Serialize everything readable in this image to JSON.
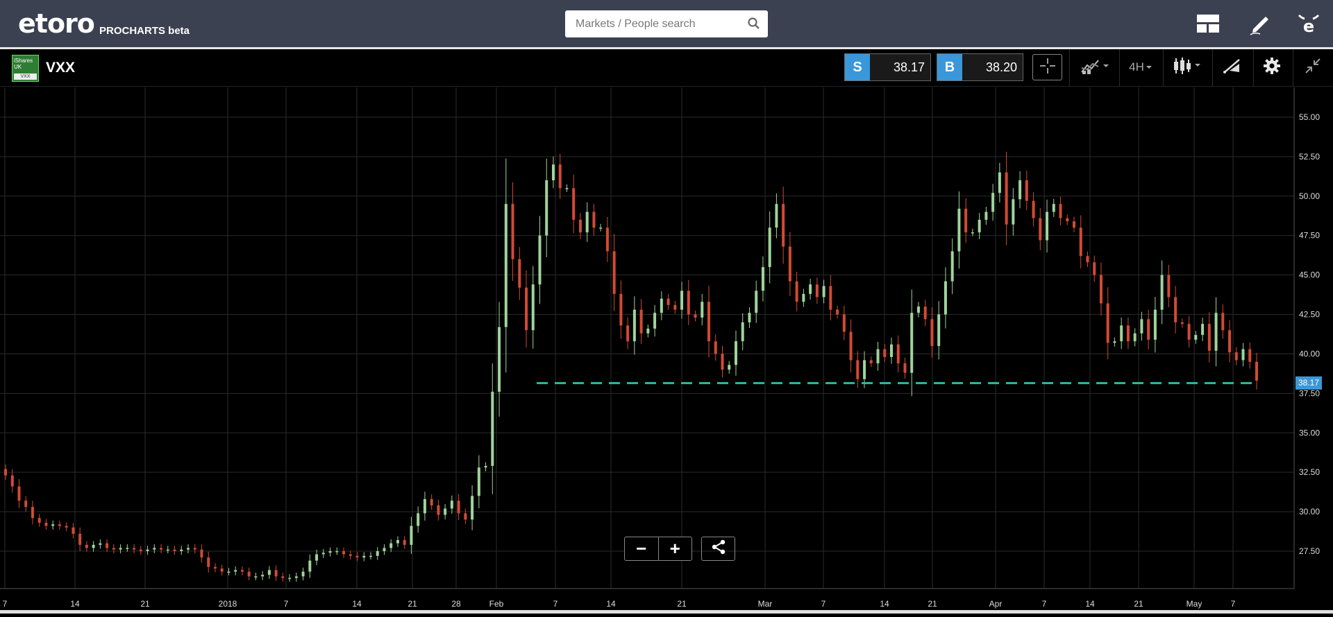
{
  "header": {
    "logo_text": "etoro",
    "logo_sub": "PROCHARTS beta",
    "search_placeholder": "Markets / People search",
    "icons": [
      "layout-icon",
      "pencil-icon",
      "etoro-e-icon"
    ]
  },
  "instrument": {
    "logo_lines": [
      "iShares",
      "UK"
    ],
    "logo_ticker": "VXX",
    "name": "VXX",
    "sell_label": "S",
    "sell_price": "38.17",
    "buy_label": "B",
    "buy_price": "38.20",
    "timeframe": "4H"
  },
  "chart_controls": {
    "zoom_out": "−",
    "zoom_in": "+"
  },
  "colors": {
    "up": "#9fd49b",
    "down": "#d24a34",
    "dashed_line": "#2fb9a0",
    "price_tag": "#3a97d9",
    "grid": "#2b2b2b"
  },
  "chart_data": {
    "type": "candlestick",
    "y_ticks": [
      "55.00",
      "52.50",
      "50.00",
      "47.50",
      "45.00",
      "42.50",
      "40.00",
      "37.50",
      "35.00",
      "32.50",
      "30.00",
      "27.50"
    ],
    "x_ticks": [
      "7",
      "14",
      "21",
      "2018",
      "7",
      "14",
      "21",
      "28",
      "Feb",
      "7",
      "14",
      "21",
      "Mar",
      "7",
      "14",
      "21",
      "Apr",
      "7",
      "14",
      "21",
      "May",
      "7"
    ],
    "ylim": [
      25.5,
      56.8
    ],
    "current_price_label": "38.17",
    "horizontal_line_value": 38.15,
    "grid": true,
    "closes": [
      32.3,
      31.6,
      30.7,
      30.3,
      29.6,
      29.3,
      29.1,
      29.2,
      29.1,
      29.0,
      28.6,
      27.9,
      27.7,
      27.9,
      28.0,
      27.7,
      27.6,
      27.7,
      27.7,
      27.6,
      27.5,
      27.6,
      27.7,
      27.6,
      27.6,
      27.5,
      27.6,
      27.7,
      27.6,
      27.1,
      26.5,
      26.4,
      26.2,
      26.2,
      26.3,
      26.2,
      25.9,
      25.9,
      26.0,
      26.3,
      25.9,
      25.8,
      25.8,
      25.9,
      26.2,
      26.9,
      27.3,
      27.4,
      27.5,
      27.5,
      27.3,
      27.2,
      27.1,
      27.2,
      27.2,
      27.5,
      27.7,
      28.0,
      28.2,
      27.9,
      29.1,
      29.9,
      30.8,
      30.4,
      29.8,
      30.2,
      30.7,
      29.9,
      29.5,
      31.0,
      32.8,
      32.9,
      37.6,
      41.7,
      49.5,
      46.0,
      44.2,
      41.5,
      44.4,
      47.5,
      51.0,
      52.0,
      50.5,
      50.5,
      48.5,
      47.7,
      49.0,
      48.0,
      48.0,
      46.5,
      43.8,
      41.8,
      40.8,
      42.8,
      41.3,
      41.6,
      42.6,
      43.5,
      43.1,
      42.8,
      44.0,
      42.5,
      42.3,
      43.3,
      40.8,
      40.0,
      39.0,
      39.3,
      40.8,
      42.0,
      42.6,
      44.0,
      45.5,
      48.0,
      49.5,
      46.8,
      44.6,
      43.3,
      43.8,
      44.4,
      43.6,
      44.3,
      42.8,
      42.5,
      41.4,
      39.6,
      38.4,
      39.6,
      39.4,
      40.3,
      39.8,
      40.6,
      39.4,
      38.8,
      42.6,
      43.0,
      42.2,
      40.5,
      42.5,
      44.6,
      46.5,
      49.2,
      47.7,
      47.7,
      48.5,
      49.0,
      50.2,
      51.5,
      48.2,
      49.8,
      51.0,
      49.7,
      48.6,
      47.2,
      49.0,
      49.5,
      48.6,
      48.4,
      48.0,
      46.2,
      45.8,
      45.0,
      43.2,
      40.7,
      40.8,
      41.8,
      40.8,
      41.3,
      42.2,
      40.9,
      42.8,
      45.0,
      43.6,
      42.0,
      41.9,
      40.9,
      41.2,
      41.9,
      40.2,
      42.6,
      41.5,
      40.1,
      39.6,
      40.3,
      39.5,
      38.3
    ],
    "xlabel": "",
    "ylabel": ""
  }
}
